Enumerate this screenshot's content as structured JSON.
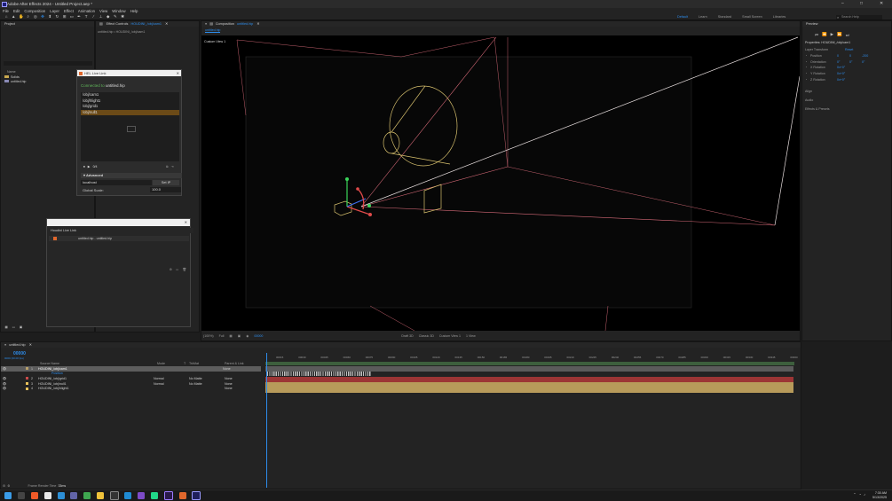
{
  "app": {
    "title": "Adobe After Effects 2024 - Untitled Project.aep *",
    "window_controls": [
      "–",
      "□",
      "✕"
    ]
  },
  "menu": [
    "File",
    "Edit",
    "Composition",
    "Layer",
    "Effect",
    "Animation",
    "View",
    "Window",
    "Help"
  ],
  "toolbar": {
    "tools": [
      "home-icon",
      "select-icon",
      "hand-icon",
      "zoom-icon",
      "orbit-icon",
      "pan-icon",
      "dolly-icon",
      "rotate-icon",
      "pan-behind-icon",
      "rect-icon",
      "pen-icon",
      "text-icon",
      "brush-icon",
      "clone-icon",
      "eraser-icon",
      "roto-icon",
      "puppet-icon"
    ],
    "workspaces": [
      "Default",
      "Learn",
      "Standard",
      "Small Screen",
      "Libraries"
    ],
    "workspace_active": "Default",
    "search_placeholder": "Search Help"
  },
  "project_panel": {
    "tab": "Project",
    "header": "Name",
    "items": [
      "Solids",
      "untitled.hip"
    ]
  },
  "effect_controls": {
    "tab": "Effect Controls",
    "tab_layer": "HOUDINI_/obj/cam1",
    "subtitle": "untitled.hip • HOUDINI_/obj/cam1"
  },
  "houdini_live_link_dialog": {
    "title": "HEL Live Link",
    "file_label": "Connected to",
    "file_name": "untitled.hip",
    "items": [
      "/obj/cam1",
      "/obj/hlight1",
      "/obj/grid1",
      "/obj/null1"
    ],
    "selected_index": 3,
    "frame_label": "0/4",
    "advanced_label": "Advanced",
    "host_value": "localhost",
    "set_ip_label": "Set IP",
    "global_scale_label": "Global Scale:",
    "global_scale_value": "100.0"
  },
  "houdini_live_link_panel": {
    "tab": "Houdini Live Link",
    "entry": "untitled.hip - untitled.hip"
  },
  "composition": {
    "tab": "Composition",
    "comp_name": "untitled.hip",
    "sub_tab": "untitled.hip",
    "view_label": "Custom View 1",
    "footer": {
      "zoom": "(100%)",
      "resolution": "Full",
      "timecode": "00000",
      "renderer": "Draft 3D",
      "camera": "Classic 3D",
      "view": "Custom View 1",
      "views_count": "1 View"
    }
  },
  "properties_panel": {
    "tab": "Preview",
    "title": "Properties: HOUDINI_/obj/cam1",
    "section": "Layer Transform",
    "reset": "Reset",
    "rows": [
      {
        "label": "Position",
        "v1": "0",
        "v2": "0",
        "v3": "-200"
      },
      {
        "label": "Orientation",
        "v1": "0°",
        "v2": "0°",
        "v3": "0°"
      },
      {
        "label": "X Rotation",
        "v1": "0x+0°",
        "v2": "",
        "v3": ""
      },
      {
        "label": "Y Rotation",
        "v1": "0x+0°",
        "v2": "",
        "v3": ""
      },
      {
        "label": "Z Rotation",
        "v1": "0x+0°",
        "v2": "",
        "v3": ""
      }
    ],
    "other_sections": [
      "Align",
      "Audio",
      "Effects & Presets"
    ]
  },
  "timeline": {
    "tab": "untitled.hip",
    "timecode": "00000",
    "fps": "0000 (30.00 fps)",
    "columns": [
      "Source Name",
      "Mode",
      "T",
      "TrkMat",
      "Parent & Link"
    ],
    "layers": [
      {
        "index": "1",
        "name": "HOUDINI_/obj/cam1",
        "mode": "",
        "parent": "None",
        "color": "#b8a06a",
        "selected": true
      },
      {
        "index": "",
        "name": "Position",
        "mode": "",
        "parent": "",
        "color": "",
        "selected": false
      },
      {
        "index": "2",
        "name": "HOUDINI_/obj/grid1",
        "mode": "Normal",
        "parent": "None",
        "color": "#c84a4a",
        "selected": false
      },
      {
        "index": "3",
        "name": "HOUDINI_/obj/null1",
        "mode": "Normal",
        "parent": "None",
        "color": "#e8c15a",
        "selected": false
      },
      {
        "index": "4",
        "name": "HOUDINI_/obj/hlight1",
        "mode": "",
        "parent": "None",
        "color": "#e8c15a",
        "selected": false
      }
    ],
    "trkmat": "No Matte",
    "ruler": [
      "00015",
      "00030",
      "00045",
      "00060",
      "00075",
      "00090",
      "00105",
      "00120",
      "00135",
      "00150",
      "00165",
      "00180",
      "00195",
      "00210",
      "00225",
      "00240",
      "00255",
      "00270",
      "00285",
      "00300",
      "00315",
      "00330",
      "00345",
      "00360"
    ],
    "track_colors": [
      "#5b5b5b",
      "#9c3535",
      "#b79a5a",
      "#b79a5a",
      "#b79a5a"
    ],
    "render_label": "Frame Render Time",
    "render_value": "33ms"
  },
  "taskbar": {
    "apps": [
      "windows-icon",
      "search-icon",
      "brave-icon",
      "store-icon",
      "edge-icon",
      "teams-icon",
      "chrome-icon",
      "files-icon",
      "terminal-icon",
      "vscode-icon",
      "vs-icon",
      "pycharm-icon",
      "premiere-icon",
      "houdini-icon",
      "aftereffects-icon"
    ],
    "time": "7:30 AM",
    "date": "5/13/2025"
  },
  "colors": {
    "accent": "#2d8ceb",
    "cam_wire": "#d66a78",
    "frustum": "#e9e0e0",
    "hlight": "#d7c06d",
    "playhead": "#2d8ceb"
  }
}
